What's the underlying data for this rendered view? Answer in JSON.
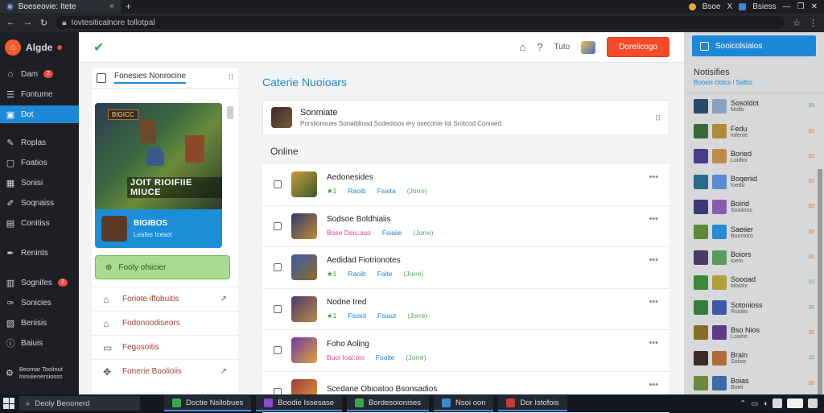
{
  "browser": {
    "tab_title": "Boeseovie: Itete",
    "tab_close": "×",
    "newtab": "+",
    "address": "Iovtesiticalnore tollotpal",
    "right_labels": [
      "Bsoe",
      "X",
      "Bsiess"
    ],
    "window_controls": [
      "—",
      "❐",
      "✕"
    ]
  },
  "app": {
    "brand": "Algde",
    "nav": [
      {
        "label": "Dam",
        "icon": "home-icon",
        "badge": "2"
      },
      {
        "label": "Fontume",
        "icon": "list-icon"
      },
      {
        "label": "Dot",
        "icon": "chat-icon",
        "active": true
      },
      {
        "label": "Roplas",
        "icon": "wrench-icon"
      },
      {
        "label": "Foatios",
        "icon": "folder-icon"
      },
      {
        "label": "Sonisi",
        "icon": "calendar-icon"
      },
      {
        "label": "Soqnaiss",
        "icon": "pin-icon"
      },
      {
        "label": "Conitiss",
        "icon": "chart-icon"
      },
      {
        "label": "Renints",
        "icon": "tool-icon"
      },
      {
        "label": "Sognifes",
        "icon": "store-icon",
        "badge": "2"
      },
      {
        "label": "Sonicies",
        "icon": "hammer-icon"
      },
      {
        "label": "Benisis",
        "icon": "image-icon"
      },
      {
        "label": "Baiuis",
        "icon": "info-icon"
      },
      {
        "label": "Beomar Toolinut Innuiienersiosss",
        "icon": "settings-icon"
      }
    ]
  },
  "header": {
    "icons": [
      "house-icon",
      "help-icon"
    ],
    "label": "Tuto",
    "cta": "Dorelicogo"
  },
  "left_panel": {
    "search_label": "Fonesies Nonrocine",
    "card": {
      "badge": "BIGICC",
      "art_title": "JOIT RIOIFIIE MIUCE",
      "name": "BIGIBOS",
      "sub": "Leafes Icesot"
    },
    "green_button": "Fooly ofsicier",
    "items": [
      {
        "label": "Foriote iffobuitis",
        "icon": "home-outline-icon",
        "arrow": "↗"
      },
      {
        "label": "Fodonoodiseors",
        "icon": "bank-icon"
      },
      {
        "label": "Fegosoitis",
        "icon": "bag-icon"
      },
      {
        "label": "Fonerie Boolioiis",
        "icon": "puzzle-icon",
        "arrow": "↗"
      }
    ]
  },
  "main": {
    "title": "Caterie Nuoioars",
    "featured": {
      "title": "Sonmiate",
      "desc": "Porsiionsues Sonaibliosd Sodeoloos ery oseconie tot Srotcod Conioed.",
      "menu": "⁝⁝"
    },
    "section_label": "Online",
    "rows": [
      {
        "name": "Aedonesides",
        "m1": "1",
        "m2": "Raoib",
        "m3": "Fsaita",
        "m4": "(Jorre)",
        "m1_pink": false,
        "c1": "#c89a3a",
        "c2": "#3a5a2a"
      },
      {
        "name": "Sodsoe Boldhiaiis",
        "m1": "Bose  Deis:aso",
        "m2": "Fsiaiie",
        "m3": "(Jorre)",
        "m1_pink": true,
        "c1": "#2a3a6a",
        "c2": "#c28a3a"
      },
      {
        "name": "Aedidad Fiotrionotes",
        "m1": "1",
        "m2": "Raoib",
        "m3": "Faite",
        "m4": "(Jorre)",
        "m1_pink": false,
        "c1": "#3a5aa8",
        "c2": "#8a6a2a"
      },
      {
        "name": "Nodne Ired",
        "m1": "1",
        "m2": "Fsiaol",
        "m3": "Fsiaut",
        "m4": "(Jorre)",
        "m1_pink": false,
        "c1": "#4a3a6a",
        "c2": "#b88a4a"
      },
      {
        "name": "Foho Aoling",
        "m1": "Buoi  Ioai:oio",
        "m2": "Fooite",
        "m3": "(Jorre)",
        "m1_pink": true,
        "c1": "#6a3aa8",
        "c2": "#e0a23a"
      },
      {
        "name": "Scedane Obioatoo Bsonsadios",
        "m1": "",
        "m2": "",
        "m3": "",
        "m1_pink": false,
        "c1": "#a03a3a",
        "c2": "#e0a23a"
      }
    ]
  },
  "right_panel": {
    "button": "Sooicolsiaios",
    "title": "Notisifies",
    "sub": "Boosis clolcs l Salbo",
    "friends": [
      {
        "name": "Sosoldot",
        "sub": "Mollo",
        "st": "30",
        "c1": "#2a4a6a",
        "c2": "#8aa0c0",
        "sc": "#4caf50"
      },
      {
        "name": "Fedu",
        "sub": "Iofenie",
        "st": "30",
        "c1": "#3a6a3a",
        "c2": "#b08a3a",
        "sc": "#d87a2a"
      },
      {
        "name": "Boried",
        "sub": "Loidtoi",
        "st": "30",
        "c1": "#4a3a8a",
        "c2": "#c08a4a",
        "sc": "#d87a2a"
      },
      {
        "name": "Boqeriid",
        "sub": "Ioedo",
        "st": "30",
        "c1": "#2a6a8a",
        "c2": "#5a8ad0",
        "sc": "#d87a2a"
      },
      {
        "name": "Boirid",
        "sub": "Soiolnos",
        "st": "30",
        "c1": "#3a3a7a",
        "c2": "#8a5ab0",
        "sc": "#d87a2a"
      },
      {
        "name": "Saeiier",
        "sub": "Buonioro",
        "st": "30",
        "c1": "#5a8a3a",
        "c2": "#2a8ad0",
        "sc": "#d87a2a"
      },
      {
        "name": "Boiors",
        "sub": "Ioeio",
        "st": "30",
        "c1": "#4a3a6a",
        "c2": "#5a9a5a",
        "sc": "#d87a2a"
      },
      {
        "name": "Soooad",
        "sub": "Moiohi",
        "st": "10",
        "c1": "#3a8a3a",
        "c2": "#b0a03a",
        "sc": "#4caf50"
      },
      {
        "name": "Sotonioss",
        "sub": "Rsiolio",
        "st": "30",
        "c1": "#3a7a3a",
        "c2": "#3a5aa8",
        "sc": "#4caf50"
      },
      {
        "name": "Bso Nios",
        "sub": "Losirio",
        "st": "30",
        "c1": "#8a6a2a",
        "c2": "#5a3a8a",
        "sc": "#d87a2a"
      },
      {
        "name": "Brain",
        "sub": "Soliso",
        "st": "10",
        "c1": "#3a2a2a",
        "c2": "#b06a3a",
        "sc": "#4caf50"
      },
      {
        "name": "Boias",
        "sub": "Boiei",
        "st": "30",
        "c1": "#6a8a3a",
        "c2": "#3a6aa8",
        "sc": "#d87a2a"
      }
    ]
  },
  "taskbar": {
    "search": "Deoly Benonerd",
    "apps": [
      {
        "label": "Doctie Nsilobues",
        "color": "#3aa84a"
      },
      {
        "label": "Boodie Issesase",
        "color": "#8a4ad0"
      },
      {
        "label": "Bordesoionises",
        "color": "#3aa84a"
      },
      {
        "label": "Nsoi oon",
        "color": "#3a8ad8"
      },
      {
        "label": "Dor Istofois",
        "color": "#c83a3a"
      }
    ]
  }
}
